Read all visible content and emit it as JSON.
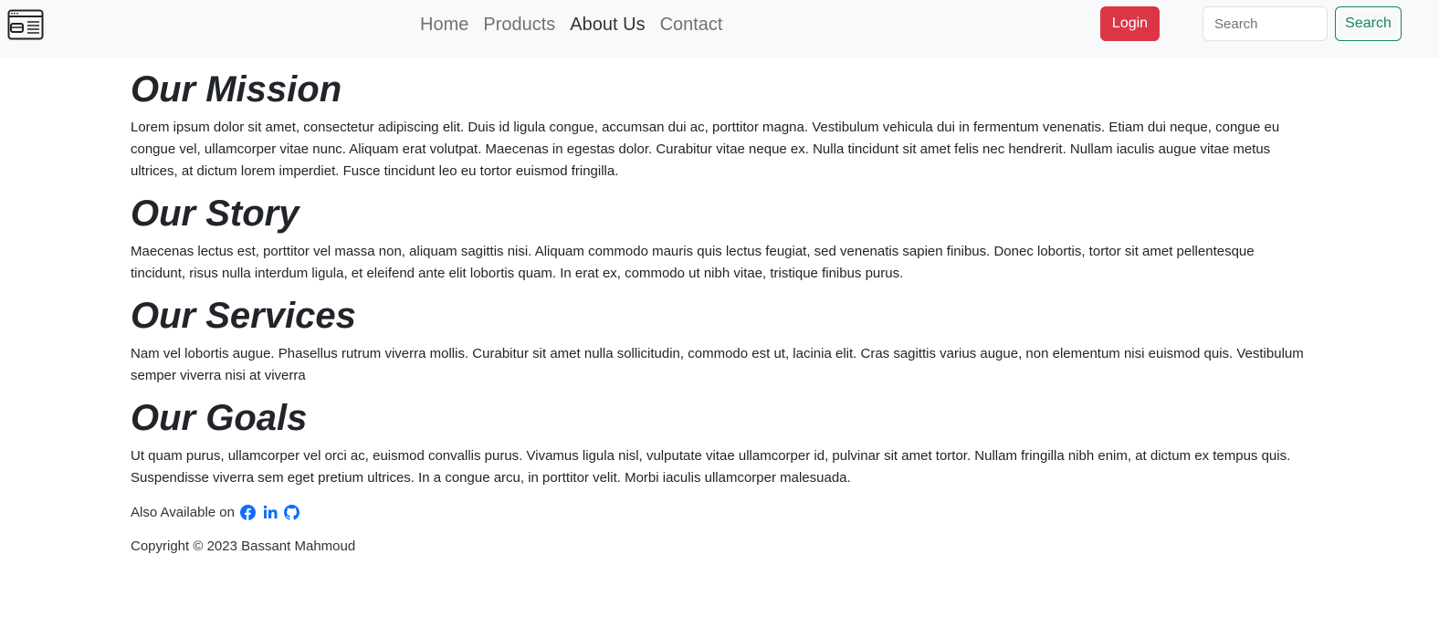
{
  "nav": {
    "links": [
      {
        "label": "Home"
      },
      {
        "label": "Products"
      },
      {
        "label": "About Us"
      },
      {
        "label": "Contact"
      }
    ],
    "active_index": 2,
    "login_label": "Login",
    "search_placeholder": "Search",
    "search_button_label": "Search"
  },
  "sections": [
    {
      "title": "Our Mission",
      "body": "Lorem ipsum dolor sit amet, consectetur adipiscing elit. Duis id ligula congue, accumsan dui ac, porttitor magna. Vestibulum vehicula dui in fermentum venenatis. Etiam dui neque, congue eu congue vel, ullamcorper vitae nunc. Aliquam erat volutpat. Maecenas in egestas dolor. Curabitur vitae neque ex. Nulla tincidunt sit amet felis nec hendrerit. Nullam iaculis augue vitae metus ultrices, at dictum lorem imperdiet. Fusce tincidunt leo eu tortor euismod fringilla."
    },
    {
      "title": "Our Story",
      "body": "Maecenas lectus est, porttitor vel massa non, aliquam sagittis nisi. Aliquam commodo mauris quis lectus feugiat, sed venenatis sapien finibus. Donec lobortis, tortor sit amet pellentesque tincidunt, risus nulla interdum ligula, et eleifend ante elit lobortis quam. In erat ex, commodo ut nibh vitae, tristique finibus purus."
    },
    {
      "title": "Our Services",
      "body": "Nam vel lobortis augue. Phasellus rutrum viverra mollis. Curabitur sit amet nulla sollicitudin, commodo est ut, lacinia elit. Cras sagittis varius augue, non elementum nisi euismod quis. Vestibulum semper viverra nisi at viverra"
    },
    {
      "title": "Our Goals",
      "body": "Ut quam purus, ullamcorper vel orci ac, euismod convallis purus. Vivamus ligula nisl, vulputate vitae ullamcorper id, pulvinar sit amet tortor. Nullam fringilla nibh enim, at dictum ex tempus quis. Suspendisse viverra sem eget pretium ultrices. In a congue arcu, in porttitor velit. Morbi iaculis ullamcorper malesuada."
    }
  ],
  "footer": {
    "available_label": "Also Available on",
    "social_icons": [
      "facebook-icon",
      "linkedin-icon",
      "github-icon"
    ],
    "copyright": "Copyright © 2023 Bassant Mahmoud"
  },
  "colors": {
    "navbar_bg": "#f8f9fa",
    "login_bg": "#dc3545",
    "search_button": "#198754",
    "social_icon": "#0d6efd"
  }
}
